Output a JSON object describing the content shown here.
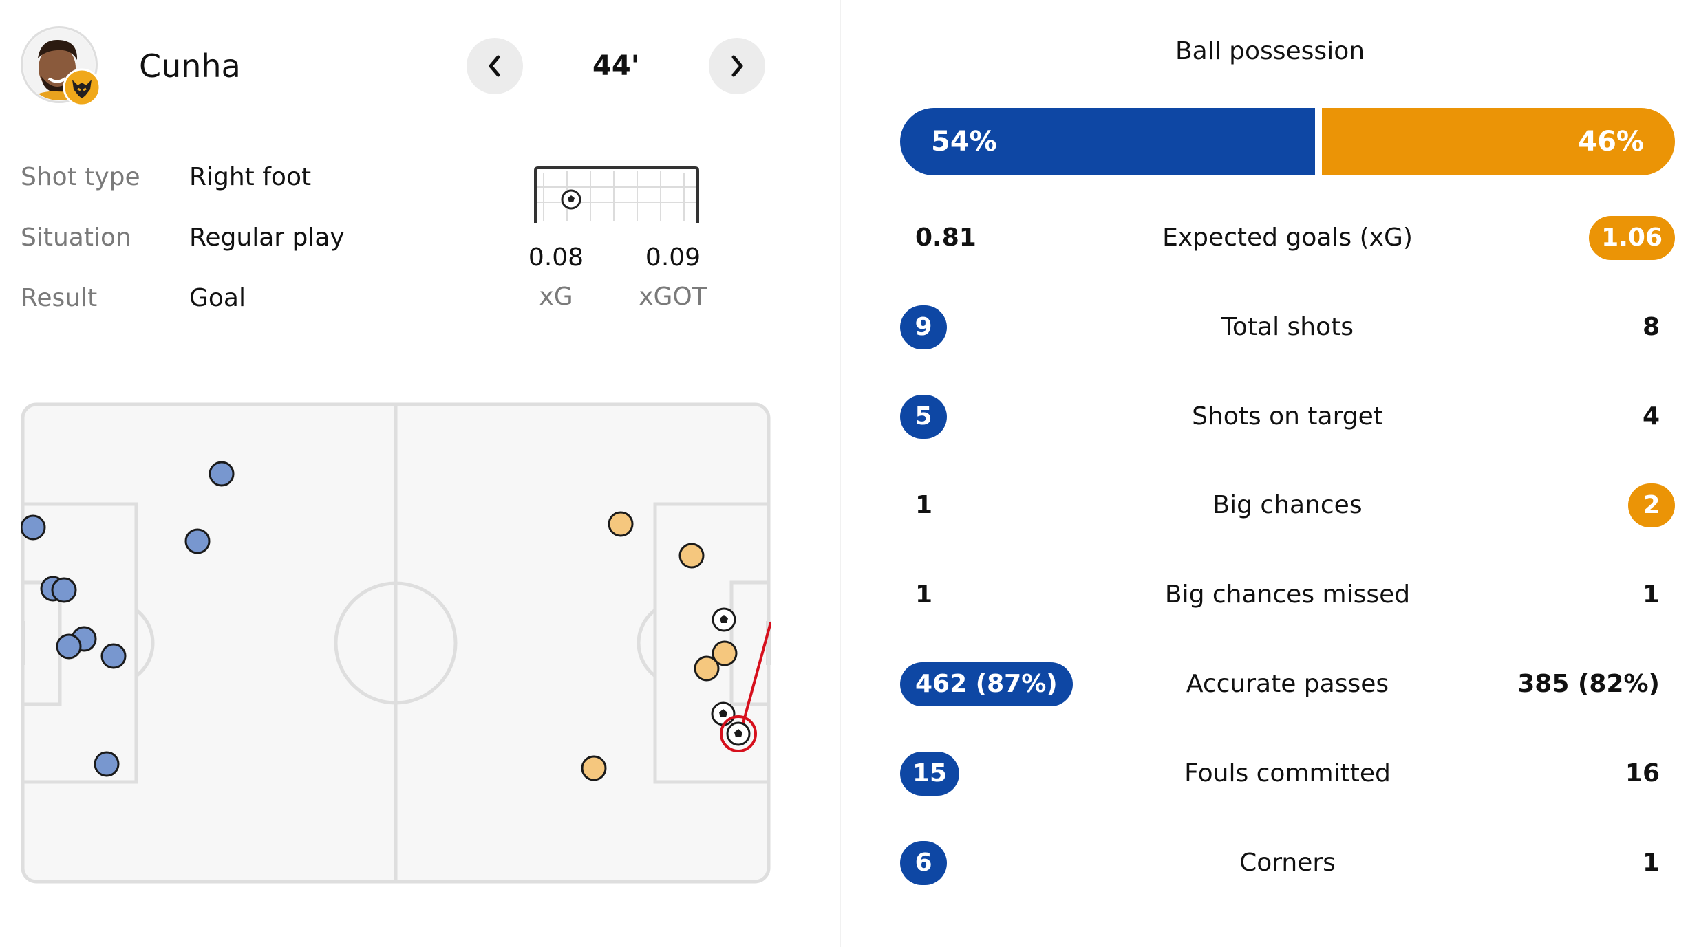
{
  "player": {
    "name": "Cunha"
  },
  "event": {
    "minute": "44'"
  },
  "shot_details": [
    {
      "label": "Shot type",
      "value": "Right foot"
    },
    {
      "label": "Situation",
      "value": "Regular play"
    },
    {
      "label": "Result",
      "value": "Goal"
    }
  ],
  "shot_metrics": {
    "xg_value": "0.08",
    "xg_label": "xG",
    "xgot_value": "0.09",
    "xgot_label": "xGOT"
  },
  "colors": {
    "home": "#0e47a4",
    "away": "#eb9406",
    "home_marker": "#7897cf",
    "away_marker": "#f5c77e",
    "highlight": "#d6101d"
  },
  "icons": {
    "prev": "chevron-left-icon",
    "next": "chevron-right-icon",
    "team_badge": "wolves-badge-icon",
    "ball": "football-icon"
  },
  "possession": {
    "title": "Ball possession",
    "home": "54%",
    "away": "46%",
    "home_share": 0.54
  },
  "stats": [
    {
      "label": "Expected goals (xG)",
      "home": "0.81",
      "away": "1.06",
      "highlight": "away"
    },
    {
      "label": "Total shots",
      "home": "9",
      "away": "8",
      "highlight": "home"
    },
    {
      "label": "Shots on target",
      "home": "5",
      "away": "4",
      "highlight": "home"
    },
    {
      "label": "Big chances",
      "home": "1",
      "away": "2",
      "highlight": "away"
    },
    {
      "label": "Big chances missed",
      "home": "1",
      "away": "1",
      "highlight": "none"
    },
    {
      "label": "Accurate passes",
      "home": "462 (87%)",
      "away": "385 (82%)",
      "highlight": "home"
    },
    {
      "label": "Fouls committed",
      "home": "15",
      "away": "16",
      "highlight": "home"
    },
    {
      "label": "Corners",
      "home": "6",
      "away": "1",
      "highlight": "home"
    }
  ]
}
